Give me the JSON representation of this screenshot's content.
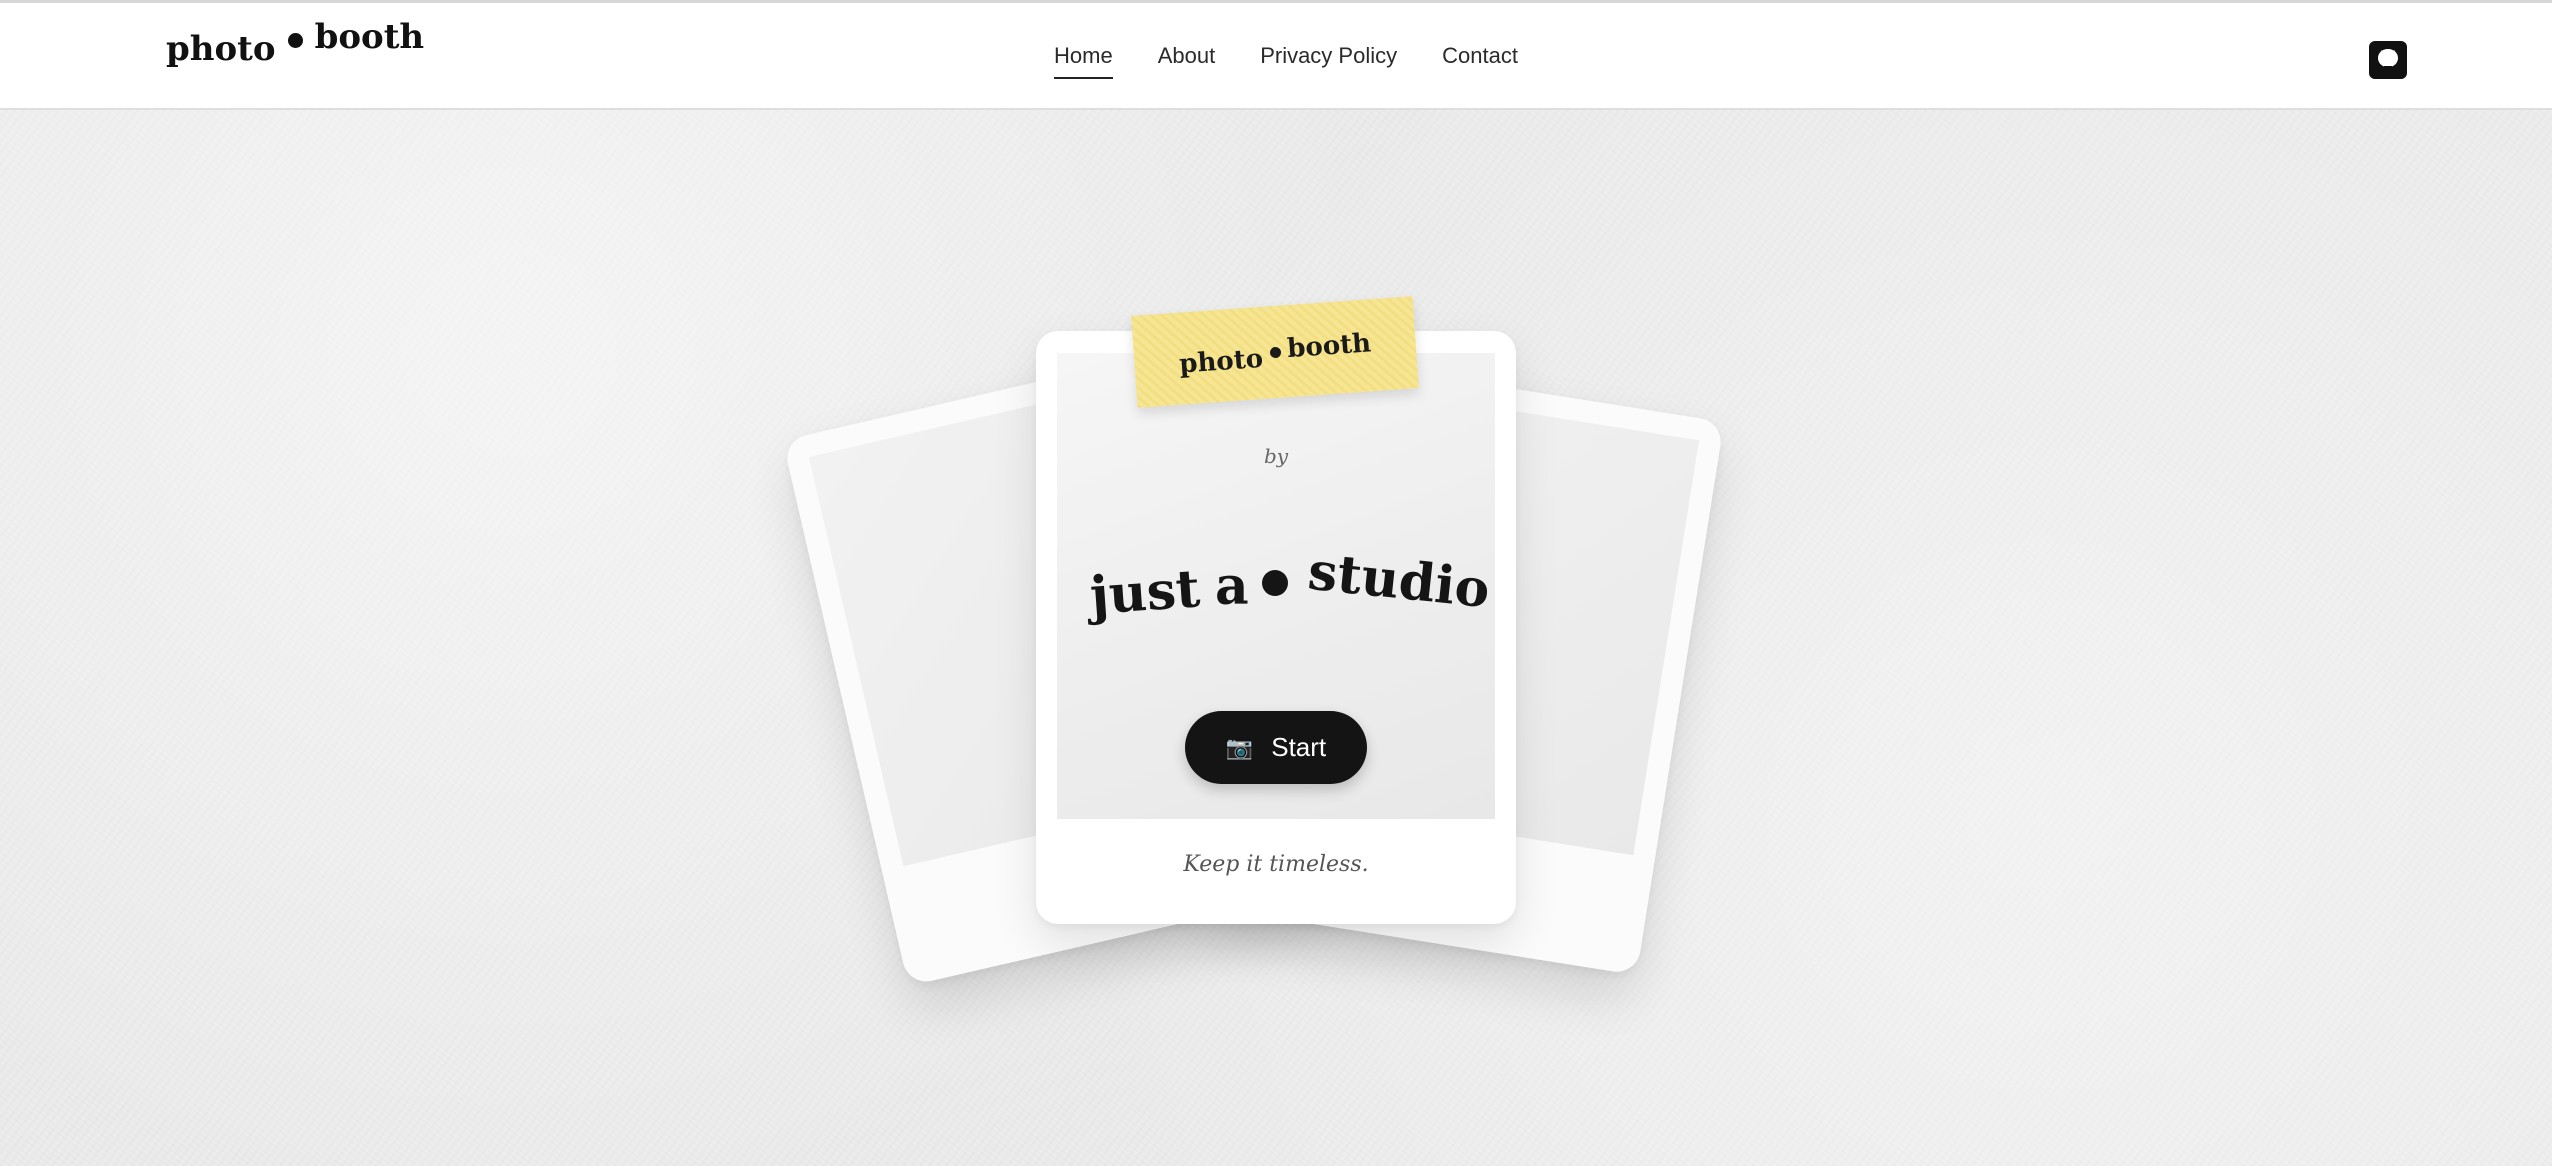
{
  "header": {
    "logo": {
      "word1": "photo",
      "word2": "booth"
    },
    "nav": [
      {
        "label": "Home",
        "active": true
      },
      {
        "label": "About",
        "active": false
      },
      {
        "label": "Privacy Policy",
        "active": false
      },
      {
        "label": "Contact",
        "active": false
      }
    ],
    "github_icon": "github-icon"
  },
  "card": {
    "tape": {
      "word1": "photo",
      "word2": "booth"
    },
    "by_label": "by",
    "studio": {
      "word1": "just",
      "word2": "a",
      "word3": "studio"
    },
    "start_button": {
      "icon": "camera-icon",
      "label": "Start"
    },
    "tagline": "Keep it timeless."
  },
  "colors": {
    "tape": "#f3df82",
    "button": "#141414",
    "background": "#ececec"
  }
}
